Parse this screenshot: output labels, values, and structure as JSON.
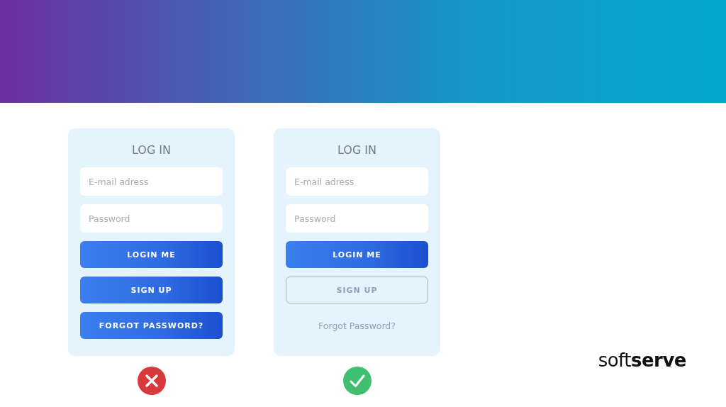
{
  "header": {
    "kind": "banner"
  },
  "cards": [
    {
      "title": "LOG IN",
      "verdict": {
        "kind": "cross"
      },
      "fields": [
        {
          "placeholder": "E-mail adress"
        },
        {
          "placeholder": "Password"
        }
      ],
      "buttons": [
        {
          "label": "LOGIN ME",
          "kind": "filled"
        },
        {
          "label": "SIGN UP",
          "kind": "filled"
        },
        {
          "label": "FORGOT PASSWORD?",
          "kind": "filled"
        }
      ]
    },
    {
      "title": "LOG IN",
      "verdict": {
        "kind": "check"
      },
      "fields": [
        {
          "placeholder": "E-mail adress"
        },
        {
          "placeholder": "Password"
        }
      ],
      "buttons": [
        {
          "label": "LOGIN ME",
          "kind": "filled"
        },
        {
          "label": "SIGN UP",
          "kind": "outline"
        },
        {
          "label": "Forgot Password?",
          "kind": "link"
        }
      ]
    }
  ],
  "logo": "soft**serve**"
}
